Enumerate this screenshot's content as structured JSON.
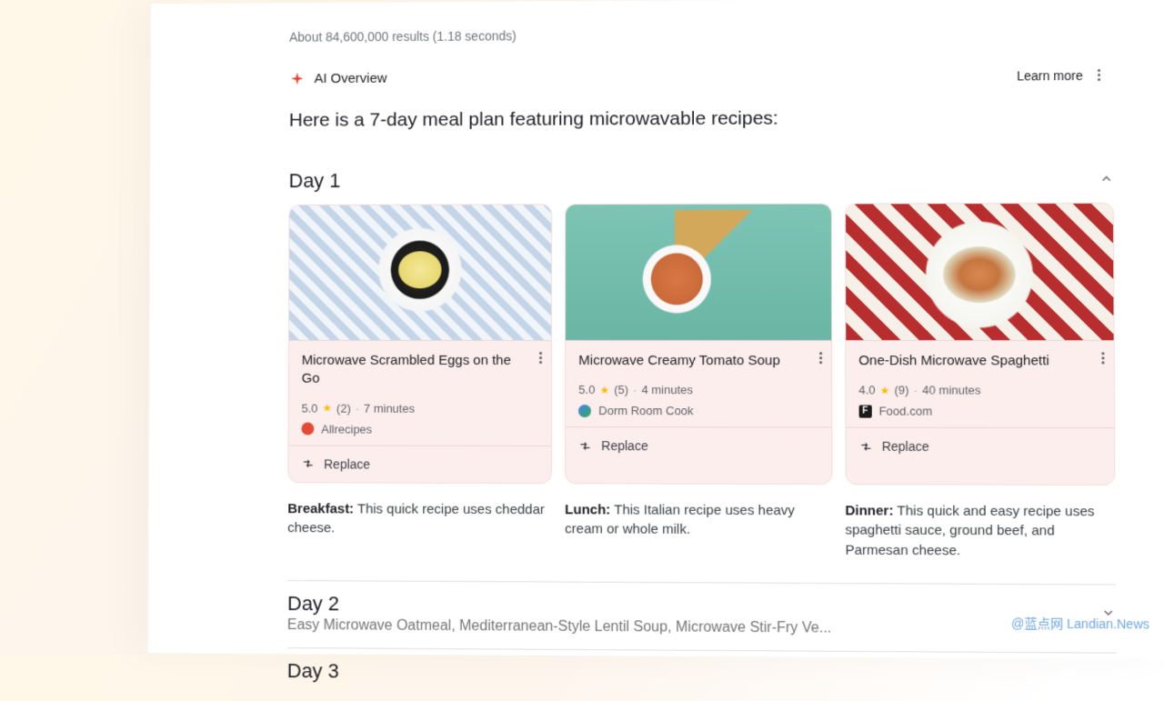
{
  "results_stats": "About 84,600,000 results (1.18 seconds)",
  "ai_overview": {
    "label": "AI Overview",
    "learn_more": "Learn more"
  },
  "intro": "Here is a 7-day meal plan featuring microwavable recipes:",
  "day1": {
    "title": "Day 1",
    "cards": [
      {
        "title": "Microwave Scrambled Eggs on the Go",
        "rating": "5.0",
        "count": "(2)",
        "time": "7 minutes",
        "source": "Allrecipes",
        "replace": "Replace",
        "meal_label": "Breakfast:",
        "desc": "This quick recipe uses cheddar cheese."
      },
      {
        "title": "Microwave Creamy Tomato Soup",
        "rating": "5.0",
        "count": "(5)",
        "time": "4 minutes",
        "source": "Dorm Room Cook",
        "replace": "Replace",
        "meal_label": "Lunch:",
        "desc": "This Italian recipe uses heavy cream or whole milk."
      },
      {
        "title": "One-Dish Microwave Spaghetti",
        "rating": "4.0",
        "count": "(9)",
        "time": "40 minutes",
        "source": "Food.com",
        "replace": "Replace",
        "meal_label": "Dinner:",
        "desc": "This quick and easy recipe uses spaghetti sauce, ground beef, and Parmesan cheese."
      }
    ]
  },
  "day2": {
    "title": "Day 2",
    "preview": "Easy Microwave Oatmeal, Mediterranean-Style Lentil Soup, Microwave Stir-Fry Ve..."
  },
  "day3": {
    "title": "Day 3"
  },
  "watermark": "@蓝点网 Landian.News"
}
